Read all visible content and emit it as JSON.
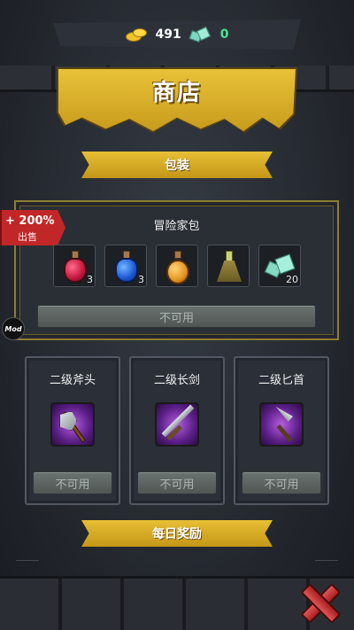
{
  "currency": {
    "gold": "491",
    "gems": "0"
  },
  "title": "商店",
  "sections": {
    "pack": "包装",
    "daily": "每日奖励"
  },
  "pack": {
    "name": "冒险家包",
    "sale_percent": "+ 200%",
    "sale_label": "出售",
    "items": [
      {
        "icon": "red-potion-icon",
        "qty": "3"
      },
      {
        "icon": "blue-potion-icon",
        "qty": "3"
      },
      {
        "icon": "orange-potion-icon",
        "qty": ""
      },
      {
        "icon": "flask-icon",
        "qty": ""
      },
      {
        "icon": "crystal-icon",
        "qty": "20"
      }
    ],
    "button": "不可用"
  },
  "weapons": [
    {
      "name": "二级斧头",
      "icon": "axe-icon",
      "button": "不可用"
    },
    {
      "name": "二级长剑",
      "icon": "sword-icon",
      "button": "不可用"
    },
    {
      "name": "二级匕首",
      "icon": "dagger-icon",
      "button": "不可用"
    }
  ],
  "mod_badge": "Mod",
  "colors": {
    "accent_gold": "#e3bb30",
    "sale_red": "#c12727",
    "gem_green": "#4be39a"
  }
}
